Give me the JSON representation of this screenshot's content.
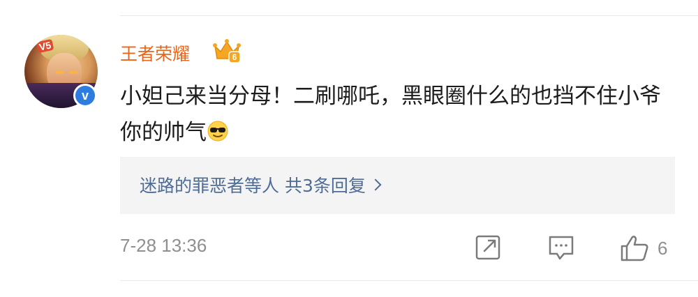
{
  "comment": {
    "username": "王者荣耀",
    "avatar_badge_text": "V5",
    "vip_level": "6",
    "text": "小妲己来当分母！二刷哪吒，黑眼圈什么的也挡不住小爷你的帅气",
    "emoji": "sunglasses-emoji",
    "replies_summary": "迷路的罪恶者等人 共3条回复",
    "timestamp": "7-28 13:36",
    "like_count": "6"
  },
  "colors": {
    "username": "#e8661b",
    "replies_link": "#4e6c96",
    "meta_gray": "#8f8f8f",
    "verified_blue": "#2d7ce0",
    "reply_box_bg": "#f4f4f4"
  }
}
